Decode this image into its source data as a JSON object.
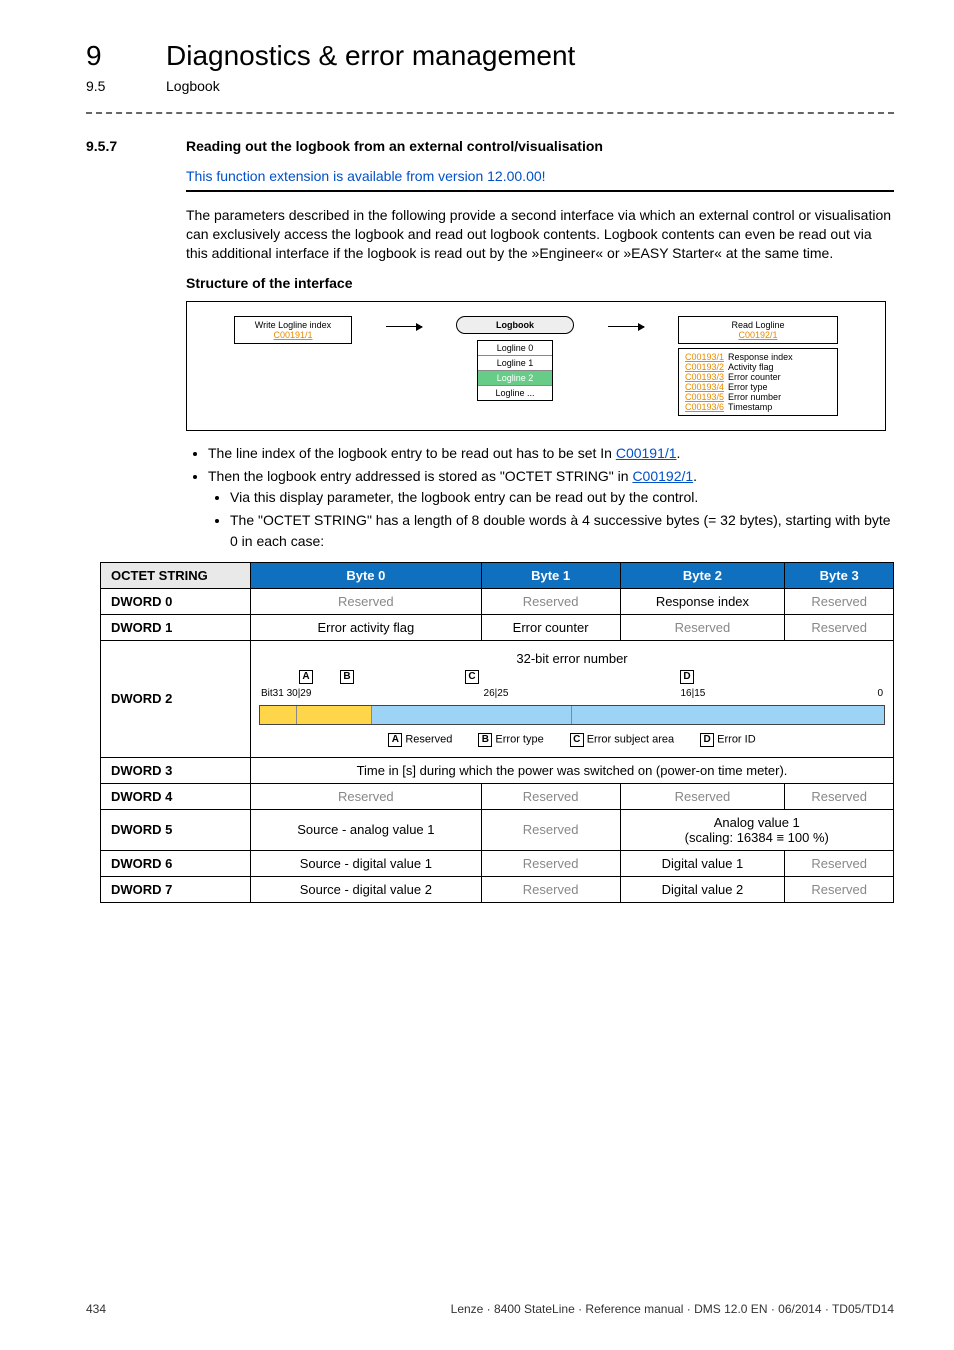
{
  "header": {
    "chapter_num": "9",
    "chapter_title": "Diagnostics & error management",
    "section_num": "9.5",
    "section_title": "Logbook"
  },
  "section": {
    "num": "9.5.7",
    "title": "Reading out the logbook from an external control/visualisation",
    "note": "This function extension is available from version 12.00.00!",
    "para": "The parameters described in the following provide a second interface via which an external control or visualisation can exclusively access the logbook and read out logbook contents. Logbook contents can even be read out via this additional interface if the logbook is read out by the »Engineer« or »EASY Starter« at the same time.",
    "struct_heading": "Structure of the interface"
  },
  "diagram": {
    "write_label": "Write Logline index",
    "write_code": "C00191/1",
    "logbook_label": "Logbook",
    "lines": [
      "Logline 0",
      "Logline 1",
      "Logline 2",
      "Logline ..."
    ],
    "read_label": "Read Logline",
    "read_code": "C00192/1",
    "read_items": [
      {
        "code": "C00193/1",
        "desc": "Response index"
      },
      {
        "code": "C00193/2",
        "desc": "Activity flag"
      },
      {
        "code": "C00193/3",
        "desc": "Error counter"
      },
      {
        "code": "C00193/4",
        "desc": "Error type"
      },
      {
        "code": "C00193/5",
        "desc": "Error number"
      },
      {
        "code": "C00193/6",
        "desc": "Timestamp"
      }
    ]
  },
  "bullets": {
    "b1a": "The line index of the logbook entry to be read out has to be set In ",
    "b1_link": "C00191/1",
    "b1b": ".",
    "b2a": "Then the logbook entry addressed is stored as \"OCTET STRING\" in ",
    "b2_link": "C00192/1",
    "b2b": ".",
    "b2s1": "Via this display parameter, the logbook entry can be read out by the control.",
    "b2s2": "The \"OCTET STRING\" has a length of 8 double words à 4 successive bytes (= 32 bytes), starting with byte 0 in each case:"
  },
  "table": {
    "head": [
      "OCTET STRING",
      "Byte 0",
      "Byte 1",
      "Byte 2",
      "Byte 3"
    ],
    "reserved": "Reserved",
    "d0": {
      "label": "DWORD 0",
      "b2": "Response index"
    },
    "d1": {
      "label": "DWORD 1",
      "b0": "Error activity flag",
      "b1": "Error counter"
    },
    "d2": {
      "label": "DWORD 2",
      "caption": "32-bit error number",
      "bitlabels": {
        "left": "Bit31 30|29",
        "mid1": "26|25",
        "mid2": "16|15",
        "right": "0"
      },
      "legend": {
        "A": "Reserved",
        "B": "Error type",
        "C": "Error subject area",
        "D": "Error ID"
      }
    },
    "d3": {
      "label": "DWORD 3",
      "text": "Time in [s] during which the power was switched on (power-on time meter)."
    },
    "d4": {
      "label": "DWORD 4"
    },
    "d5": {
      "label": "DWORD 5",
      "b0": "Source - analog value 1",
      "b23": "Analog value 1",
      "b23b": "(scaling: 16384 ≡ 100 %)"
    },
    "d6": {
      "label": "DWORD 6",
      "b0": "Source - digital value 1",
      "b2": "Digital value 1"
    },
    "d7": {
      "label": "DWORD 7",
      "b0": "Source - digital value 2",
      "b2": "Digital value 2"
    }
  },
  "footer": {
    "page": "434",
    "info": "Lenze · 8400 StateLine · Reference manual · DMS 12.0 EN · 06/2014 · TD05/TD14"
  }
}
